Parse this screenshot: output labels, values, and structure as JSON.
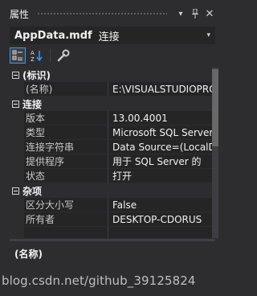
{
  "window": {
    "title": "属性",
    "buttons": {
      "dropdown": "▾",
      "pin": "🖈",
      "close": "✕"
    }
  },
  "object_selector": {
    "name": "AppData.mdf",
    "type": "连接",
    "dropdown": "▾"
  },
  "toolbar": {
    "icons": [
      "categorized-icon",
      "alphabetical-icon",
      "property-pages-icon"
    ],
    "alpha_label_top": "A",
    "alpha_label_bottom": "Z"
  },
  "grid": {
    "categories": [
      {
        "label": "(标识)",
        "rows": [
          {
            "name": "(名称)",
            "value": "E:\\VISUALSTUDIOPRO"
          }
        ]
      },
      {
        "label": "连接",
        "rows": [
          {
            "name": "版本",
            "value": "13.00.4001"
          },
          {
            "name": "类型",
            "value": "Microsoft SQL Server"
          },
          {
            "name": "连接字符串",
            "value": "Data Source=(LocalDB)"
          },
          {
            "name": "提供程序",
            "value": "用于 SQL Server 的"
          },
          {
            "name": "状态",
            "value": "打开"
          }
        ]
      },
      {
        "label": "杂项",
        "rows": [
          {
            "name": "区分大小写",
            "value": "False"
          },
          {
            "name": "所有者",
            "value": "DESKTOP-CDORUS"
          },
          {
            "name": "",
            "value": ""
          }
        ]
      }
    ]
  },
  "description": {
    "title": "(名称)"
  },
  "watermark": "blog.csdn.net/github_39125824",
  "colors": {
    "background": "#2d2d30",
    "grid": "#252526",
    "accent": "#3399ff",
    "text": "#f1f1f1"
  }
}
